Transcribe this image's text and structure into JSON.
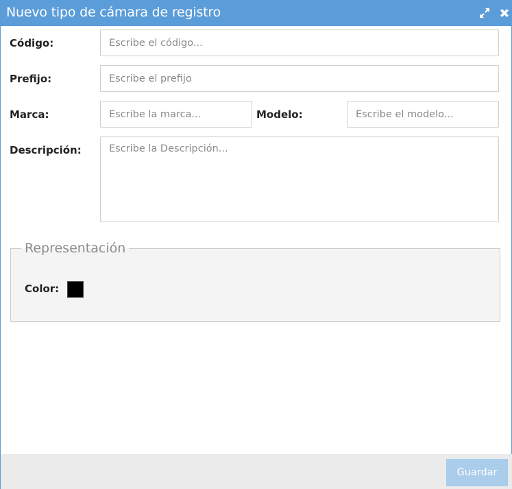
{
  "dialog": {
    "title": "Nuevo tipo de cámara de registro",
    "expand_icon": "expand-icon",
    "close_icon": "close-icon"
  },
  "form": {
    "codigo": {
      "label": "Código:",
      "placeholder": "Escribe el código...",
      "value": ""
    },
    "prefijo": {
      "label": "Prefijo:",
      "placeholder": "Escribe el prefijo",
      "value": ""
    },
    "marca": {
      "label": "Marca:",
      "placeholder": "Escribe la marca...",
      "value": ""
    },
    "modelo": {
      "label": "Modelo:",
      "placeholder": "Escribe el modelo...",
      "value": ""
    },
    "descripcion": {
      "label": "Descripción:",
      "placeholder": "Escribe la Descripción...",
      "value": ""
    }
  },
  "representacion": {
    "legend": "Representación",
    "color_label": "Color:",
    "color_value": "#000000"
  },
  "footer": {
    "save_label": "Guardar"
  },
  "colors": {
    "titlebar": "#5b9dd9",
    "save_button": "#a9cdea",
    "footer": "#ebebeb"
  }
}
